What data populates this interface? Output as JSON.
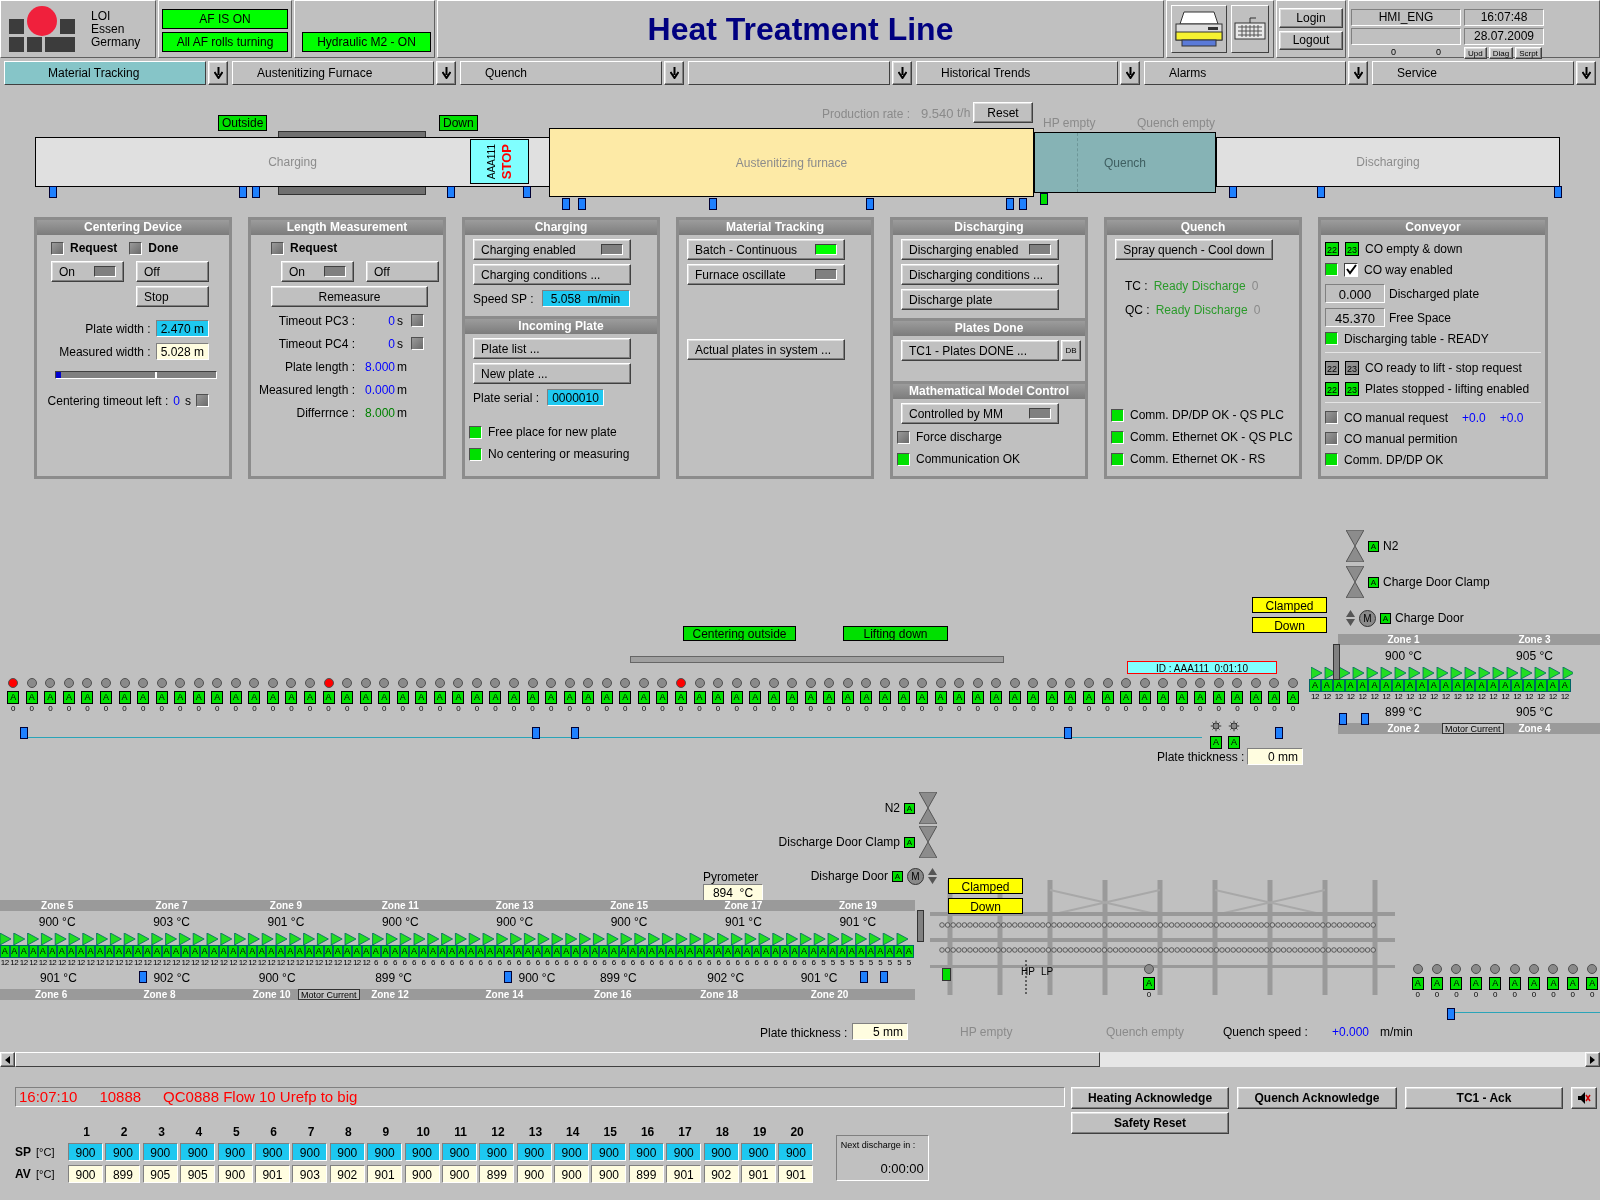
{
  "header": {
    "logo_lines": [
      "LOI",
      "Essen",
      "Germany"
    ],
    "status": [
      {
        "label": "AF IS ON",
        "on": true
      },
      {
        "label": "All AF rolls turning",
        "on": true
      },
      {
        "label": "Hydraulic M2 - ON",
        "on": true
      }
    ],
    "title": "Heat Treatment Line",
    "session_buttons": [
      "Login",
      "Logout"
    ],
    "user": "HMI_ENG",
    "time": "16:07:48",
    "date": "28.07.2009",
    "counters": [
      "0",
      "0"
    ],
    "tool_buttons": [
      "Upd",
      "Diag",
      "Scrpt"
    ]
  },
  "nav_tabs": [
    {
      "label": "Material Tracking",
      "selected": true
    },
    {
      "label": "Austenitizing Furnace",
      "selected": false
    },
    {
      "label": "Quench",
      "selected": false
    },
    {
      "selected": false
    },
    {
      "label": "Historical Trends",
      "selected": false
    },
    {
      "label": "Alarms",
      "selected": false
    },
    {
      "label": "Service",
      "selected": false
    }
  ],
  "line_overview": {
    "production_rate": {
      "label": "Production rate :",
      "value": "9.540",
      "unit": "t/h"
    },
    "reset_button": "Reset",
    "flags": [
      "Outside",
      "Down"
    ],
    "sections": [
      {
        "label": "Charging",
        "kind": "charging"
      },
      {
        "label": "Austenitizing furnace",
        "kind": "furnace"
      },
      {
        "label": "Quench",
        "kind": "quench"
      },
      {
        "label": "Discharging",
        "kind": "discharging"
      }
    ],
    "plate": {
      "id": "AAA111",
      "status": "STOP"
    },
    "notes": [
      "HP empty",
      "Quench empty"
    ]
  },
  "panels": {
    "centering": {
      "title": "Centering Device",
      "request": {
        "label": "Request",
        "on": false
      },
      "done": {
        "label": "Done",
        "on": false
      },
      "on_button": {
        "label": "On",
        "on": false
      },
      "off_button": "Off",
      "stop_button": "Stop",
      "plate_width": {
        "label": "Plate width :",
        "value": "2.470 m"
      },
      "measured_width": {
        "label": "Measured width :",
        "value": "5.028 m"
      },
      "position": {
        "level": 0.03
      },
      "timeout": {
        "label": "Centering timeout left :",
        "value": "0",
        "unit": "s",
        "on": false
      }
    },
    "length": {
      "title": "Length Measurement",
      "request": {
        "label": "Request",
        "on": false
      },
      "on_button": {
        "label": "On",
        "on": false
      },
      "off_button": "Off",
      "remeasure_button": "Remeasure",
      "rows": [
        {
          "label": "Timeout PC3 :",
          "value": "0",
          "unit": "s",
          "kind": "timer",
          "on": false
        },
        {
          "label": "Timeout PC4 :",
          "value": "0",
          "unit": "s",
          "kind": "timer",
          "on": false
        },
        {
          "label": "Plate length :",
          "value": "8.000",
          "unit": "m",
          "kind": "value"
        },
        {
          "label": "Measured length :",
          "value": "0.000",
          "unit": "m",
          "kind": "value"
        },
        {
          "label": "Differrnce :",
          "value": "8.000",
          "unit": "m",
          "kind": "difference"
        }
      ]
    },
    "charging": {
      "title": "Charging",
      "buttons": [
        {
          "label": "Charging enabled",
          "kind": "toggle",
          "on": false
        },
        {
          "label": "Charging conditions ...",
          "kind": "plain"
        }
      ],
      "speed": {
        "label": "Speed SP :",
        "value": "5.058  m/min"
      }
    },
    "incoming": {
      "title": "Incoming Plate",
      "buttons": [
        "Plate list ...",
        "New plate ..."
      ],
      "serial": {
        "label": "Plate serial :",
        "value": "0000010"
      },
      "indicators": [
        {
          "label": "Free place for new plate",
          "on": true
        },
        {
          "label": "No centering or measuring",
          "on": true
        }
      ]
    },
    "tracking": {
      "title": "Material Tracking",
      "buttons": [
        {
          "label": "Batch - Continuous",
          "kind": "toggle",
          "on": true
        },
        {
          "label": "Furnace oscillate",
          "kind": "toggle",
          "on": false
        },
        {
          "label": "Actual plates in system ...",
          "kind": "plain"
        }
      ]
    },
    "discharging": {
      "title": "Discharging",
      "buttons": [
        {
          "label": "Discharging enabled",
          "kind": "toggle",
          "on": false
        },
        {
          "label": "Discharging conditions ...",
          "kind": "plain"
        },
        {
          "label": "Discharge plate",
          "kind": "plain"
        }
      ]
    },
    "plates_done": {
      "title": "Plates Done",
      "button": "TC1 - Plates DONE ...",
      "db_button": "DB"
    },
    "mm_control": {
      "title": "Mathematical Model Control",
      "button": {
        "label": "Controlled by MM",
        "on": false
      },
      "indicators": [
        {
          "label": "Force discharge",
          "on": false
        },
        {
          "label": "Communication OK",
          "on": true
        }
      ]
    },
    "quench": {
      "title": "Quench",
      "button": "Spray quench - Cool down",
      "status": [
        {
          "label": "TC :",
          "value": "Ready Discharge",
          "count": "0"
        },
        {
          "label": "QC :",
          "value": "Ready Discharge",
          "count": "0"
        }
      ],
      "indicators": [
        {
          "label": "Comm. DP/DP OK - QS PLC",
          "on": true
        },
        {
          "label": "Comm. Ethernet OK - QS PLC",
          "on": true
        },
        {
          "label": "Comm. Ethernet OK - RS",
          "on": true
        }
      ]
    },
    "conveyor": {
      "title": "Conveyor",
      "groups": [
        [
          {
            "kind": "pair",
            "codes": [
              {
                "label": "22",
                "on": true
              },
              {
                "label": "23",
                "on": true
              }
            ],
            "label": "CO empty & down"
          },
          {
            "kind": "check",
            "on": true,
            "checked": true,
            "label": "CO way enabled"
          },
          {
            "kind": "value",
            "value": "0.000",
            "label": "Discharged plate"
          },
          {
            "kind": "value",
            "value": "45.370",
            "label": "Free Space"
          },
          {
            "kind": "lamp",
            "on": true,
            "label": "Discharging table - READY"
          }
        ],
        [
          {
            "kind": "pair",
            "codes": [
              {
                "label": "22",
                "on": false
              },
              {
                "label": "23",
                "on": false
              }
            ],
            "label": "CO ready to lift - stop request"
          },
          {
            "kind": "pair",
            "codes": [
              {
                "label": "22",
                "on": true
              },
              {
                "label": "23",
                "on": true
              }
            ],
            "label": "Plates stopped - lifting enabled"
          }
        ],
        [
          {
            "kind": "lamp",
            "on": false,
            "label": "CO manual request",
            "readings": [
              "+0.0",
              "+0.0"
            ]
          },
          {
            "kind": "lamp",
            "on": false,
            "label": "CO manual permition"
          },
          {
            "kind": "lamp",
            "on": true,
            "label": "Comm. DP/DP OK"
          }
        ]
      ]
    }
  },
  "upper_line": {
    "flags": [
      "Centering outside",
      "Lifting down"
    ],
    "plate_id": "ID : AAA111  0:01:10",
    "rollers": [
      {
        "tag": "A",
        "count": "0",
        "fault": true
      },
      {
        "tag": "A",
        "count": "0",
        "fault": false
      },
      {
        "tag": "A",
        "count": "0",
        "fault": false
      },
      {
        "tag": "A",
        "count": "0",
        "fault": false
      },
      {
        "tag": "A",
        "count": "0",
        "fault": false
      },
      {
        "tag": "A",
        "count": "0",
        "fault": false
      },
      {
        "tag": "A",
        "count": "0",
        "fault": false
      },
      {
        "tag": "A",
        "count": "0",
        "fault": false
      },
      {
        "tag": "A",
        "count": "0",
        "fault": false
      },
      {
        "tag": "A",
        "count": "0",
        "fault": false
      },
      {
        "tag": "A",
        "count": "0",
        "fault": false
      },
      {
        "tag": "A",
        "count": "0",
        "fault": false
      },
      {
        "tag": "A",
        "count": "0",
        "fault": false
      },
      {
        "tag": "A",
        "count": "0",
        "fault": false
      },
      {
        "tag": "A",
        "count": "0",
        "fault": false
      },
      {
        "tag": "A",
        "count": "0",
        "fault": false
      },
      {
        "tag": "A",
        "count": "0",
        "fault": false
      },
      {
        "tag": "A",
        "count": "0",
        "fault": true
      },
      {
        "tag": "A",
        "count": "0",
        "fault": false
      },
      {
        "tag": "A",
        "count": "0",
        "fault": false
      },
      {
        "tag": "A",
        "count": "0",
        "fault": false
      },
      {
        "tag": "A",
        "count": "0",
        "fault": false
      },
      {
        "tag": "A",
        "count": "0",
        "fault": false
      },
      {
        "tag": "A",
        "count": "0",
        "fault": false
      },
      {
        "tag": "A",
        "count": "0",
        "fault": false
      },
      {
        "tag": "A",
        "count": "0",
        "fault": false
      },
      {
        "tag": "A",
        "count": "0",
        "fault": false
      },
      {
        "tag": "A",
        "count": "0",
        "fault": false
      },
      {
        "tag": "A",
        "count": "0",
        "fault": false
      },
      {
        "tag": "A",
        "count": "0",
        "fault": false
      },
      {
        "tag": "A",
        "count": "0",
        "fault": false
      },
      {
        "tag": "A",
        "count": "0",
        "fault": false
      },
      {
        "tag": "A",
        "count": "0",
        "fault": false
      },
      {
        "tag": "A",
        "count": "0",
        "fault": false
      },
      {
        "tag": "A",
        "count": "0",
        "fault": false
      },
      {
        "tag": "A",
        "count": "0",
        "fault": false
      },
      {
        "tag": "A",
        "count": "0",
        "fault": true
      },
      {
        "tag": "A",
        "count": "0",
        "fault": false
      },
      {
        "tag": "A",
        "count": "0",
        "fault": false
      },
      {
        "tag": "A",
        "count": "0",
        "fault": false
      },
      {
        "tag": "A",
        "count": "0",
        "fault": false
      },
      {
        "tag": "A",
        "count": "0",
        "fault": false
      },
      {
        "tag": "A",
        "count": "0",
        "fault": false
      },
      {
        "tag": "A",
        "count": "0",
        "fault": false
      },
      {
        "tag": "A",
        "count": "0",
        "fault": false
      },
      {
        "tag": "A",
        "count": "0",
        "fault": false
      },
      {
        "tag": "A",
        "count": "0",
        "fault": false
      },
      {
        "tag": "A",
        "count": "0",
        "fault": false
      },
      {
        "tag": "A",
        "count": "0",
        "fault": false
      },
      {
        "tag": "A",
        "count": "0",
        "fault": false
      },
      {
        "tag": "A",
        "count": "0",
        "fault": false
      },
      {
        "tag": "A",
        "count": "0",
        "fault": false
      },
      {
        "tag": "A",
        "count": "0",
        "fault": false
      },
      {
        "tag": "A",
        "count": "0",
        "fault": false
      },
      {
        "tag": "A",
        "count": "0",
        "fault": false
      },
      {
        "tag": "A",
        "count": "0",
        "fault": false
      },
      {
        "tag": "A",
        "count": "0",
        "fault": false
      },
      {
        "tag": "A",
        "count": "0",
        "fault": false
      },
      {
        "tag": "A",
        "count": "0",
        "fault": false
      },
      {
        "tag": "A",
        "count": "0",
        "fault": false
      },
      {
        "tag": "A",
        "count": "0",
        "fault": false
      },
      {
        "tag": "A",
        "count": "0",
        "fault": false
      },
      {
        "tag": "A",
        "count": "0",
        "fault": false
      },
      {
        "tag": "A",
        "count": "0",
        "fault": false
      },
      {
        "tag": "A",
        "count": "0",
        "fault": false
      },
      {
        "tag": "A",
        "count": "0",
        "fault": false
      },
      {
        "tag": "A",
        "count": "0",
        "fault": false
      },
      {
        "tag": "A",
        "count": "0",
        "fault": false
      },
      {
        "tag": "A",
        "count": "0",
        "fault": false
      },
      {
        "tag": "A",
        "count": "0",
        "fault": false
      }
    ],
    "fans": [
      {
        "mode": "A"
      },
      {
        "mode": "A"
      }
    ],
    "plate_thickness": {
      "label": "Plate thickness :",
      "value": "0 mm"
    },
    "actuators": [
      {
        "kind": "valve",
        "mode": "A",
        "label": "N2"
      },
      {
        "kind": "valve",
        "mode": "A",
        "label": "Charge Door Clamp"
      },
      {
        "kind": "motor",
        "mode": "A",
        "motor": "M",
        "label": "Charge Door"
      }
    ],
    "door_states": [
      "Clamped",
      "Down"
    ],
    "furnace": {
      "zones_top": [
        {
          "name": "Zone 1",
          "temp": "900 °C"
        },
        {
          "name": "Zone 3",
          "temp": "905 °C"
        }
      ],
      "zones_bottom": [
        {
          "name": "Zone 2",
          "temp": "899 °C"
        },
        {
          "name": "Zone 4",
          "temp": "905 °C"
        }
      ],
      "motor_current": "Motor Current",
      "rollers": [
        {
          "tag": "A",
          "count": "12"
        },
        {
          "tag": "A",
          "count": "12"
        },
        {
          "tag": "A",
          "count": "12"
        },
        {
          "tag": "A",
          "count": "12"
        },
        {
          "tag": "A",
          "count": "12"
        },
        {
          "tag": "A",
          "count": "12"
        },
        {
          "tag": "A",
          "count": "12"
        },
        {
          "tag": "A",
          "count": "12"
        },
        {
          "tag": "A",
          "count": "12"
        },
        {
          "tag": "A",
          "count": "12"
        },
        {
          "tag": "A",
          "count": "12"
        },
        {
          "tag": "A",
          "count": "12"
        },
        {
          "tag": "A",
          "count": "12"
        },
        {
          "tag": "A",
          "count": "12"
        },
        {
          "tag": "A",
          "count": "12"
        },
        {
          "tag": "A",
          "count": "12"
        },
        {
          "tag": "A",
          "count": "12"
        },
        {
          "tag": "A",
          "count": "12"
        },
        {
          "tag": "A",
          "count": "12"
        },
        {
          "tag": "A",
          "count": "12"
        },
        {
          "tag": "A",
          "count": "12"
        },
        {
          "tag": "A",
          "count": "12"
        }
      ]
    }
  },
  "lower_line": {
    "actuators": [
      {
        "kind": "valve",
        "mode": "A",
        "label": "N2"
      },
      {
        "kind": "valve",
        "mode": "A",
        "label": "Discharge Door Clamp"
      },
      {
        "kind": "motor",
        "mode": "A",
        "motor": "M",
        "label": "Disharge Door"
      }
    ],
    "pyrometer": {
      "label": "Pyrometer",
      "value": "894  °C"
    },
    "door_states": [
      "Clamped",
      "Down"
    ],
    "furnace": {
      "zones_top": [
        {
          "name": "Zone 5",
          "temp": "900 °C"
        },
        {
          "name": "Zone 7",
          "temp": "903 °C"
        },
        {
          "name": "Zone 9",
          "temp": "901 °C"
        },
        {
          "name": "Zone 11",
          "temp": "900 °C"
        },
        {
          "name": "Zone 13",
          "temp": "900 °C"
        },
        {
          "name": "Zone 15",
          "temp": "900 °C"
        },
        {
          "name": "Zone 17",
          "temp": "901 °C"
        },
        {
          "name": "Zone 19",
          "temp": "901 °C"
        }
      ],
      "zones_bottom": [
        {
          "name": "Zone 6",
          "temp": "901 °C"
        },
        {
          "name": "Zone 8",
          "temp": "902 °C"
        },
        {
          "name": "Zone 10",
          "temp": "900 °C"
        },
        {
          "name": "Zone 12",
          "temp": "899 °C"
        },
        {
          "name": "Zone 14",
          "temp": "900 °C"
        },
        {
          "name": "Zone 16",
          "temp": "899 °C"
        },
        {
          "name": "Zone 18",
          "temp": "902 °C"
        },
        {
          "name": "Zone 20",
          "temp": "901 °C"
        }
      ],
      "motor_current": "Motor Current",
      "rollers": [
        {
          "tag": "A",
          "count": "12"
        },
        {
          "tag": "A",
          "count": "12"
        },
        {
          "tag": "A",
          "count": "12"
        },
        {
          "tag": "A",
          "count": "12"
        },
        {
          "tag": "A",
          "count": "12"
        },
        {
          "tag": "A",
          "count": "12"
        },
        {
          "tag": "A",
          "count": "12"
        },
        {
          "tag": "A",
          "count": "12"
        },
        {
          "tag": "A",
          "count": "12"
        },
        {
          "tag": "A",
          "count": "12"
        },
        {
          "tag": "A",
          "count": "12"
        },
        {
          "tag": "A",
          "count": "12"
        },
        {
          "tag": "A",
          "count": "12"
        },
        {
          "tag": "A",
          "count": "12"
        },
        {
          "tag": "A",
          "count": "12"
        },
        {
          "tag": "A",
          "count": "12"
        },
        {
          "tag": "A",
          "count": "12"
        },
        {
          "tag": "A",
          "count": "12"
        },
        {
          "tag": "A",
          "count": "12"
        },
        {
          "tag": "A",
          "count": "12"
        },
        {
          "tag": "A",
          "count": "12"
        },
        {
          "tag": "A",
          "count": "12"
        },
        {
          "tag": "A",
          "count": "12"
        },
        {
          "tag": "A",
          "count": "12"
        },
        {
          "tag": "A",
          "count": "12"
        },
        {
          "tag": "A",
          "count": "12"
        },
        {
          "tag": "A",
          "count": "12"
        },
        {
          "tag": "A",
          "count": "12"
        },
        {
          "tag": "A",
          "count": "12"
        },
        {
          "tag": "A",
          "count": "12"
        },
        {
          "tag": "A",
          "count": "12"
        },
        {
          "tag": "A",
          "count": "12"
        },
        {
          "tag": "A",
          "count": "12"
        },
        {
          "tag": "A",
          "count": "12"
        },
        {
          "tag": "A",
          "count": "12"
        },
        {
          "tag": "A",
          "count": "12"
        },
        {
          "tag": "A",
          "count": "12"
        },
        {
          "tag": "A",
          "count": "12"
        },
        {
          "tag": "A",
          "count": "12"
        },
        {
          "tag": "A",
          "count": "6"
        },
        {
          "tag": "A",
          "count": "6"
        },
        {
          "tag": "A",
          "count": "6"
        },
        {
          "tag": "A",
          "count": "6"
        },
        {
          "tag": "A",
          "count": "6"
        },
        {
          "tag": "A",
          "count": "6"
        },
        {
          "tag": "A",
          "count": "6"
        },
        {
          "tag": "A",
          "count": "6"
        },
        {
          "tag": "A",
          "count": "6"
        },
        {
          "tag": "A",
          "count": "6"
        },
        {
          "tag": "A",
          "count": "6"
        },
        {
          "tag": "A",
          "count": "6"
        },
        {
          "tag": "A",
          "count": "6"
        },
        {
          "tag": "A",
          "count": "6"
        },
        {
          "tag": "A",
          "count": "6"
        },
        {
          "tag": "A",
          "count": "6"
        },
        {
          "tag": "A",
          "count": "6"
        },
        {
          "tag": "A",
          "count": "6"
        },
        {
          "tag": "A",
          "count": "6"
        },
        {
          "tag": "A",
          "count": "6"
        },
        {
          "tag": "A",
          "count": "6"
        },
        {
          "tag": "A",
          "count": "6"
        },
        {
          "tag": "A",
          "count": "6"
        },
        {
          "tag": "A",
          "count": "6"
        },
        {
          "tag": "A",
          "count": "6"
        },
        {
          "tag": "A",
          "count": "6"
        },
        {
          "tag": "A",
          "count": "6"
        },
        {
          "tag": "A",
          "count": "6"
        },
        {
          "tag": "A",
          "count": "6"
        },
        {
          "tag": "A",
          "count": "6"
        },
        {
          "tag": "A",
          "count": "6"
        },
        {
          "tag": "A",
          "count": "6"
        },
        {
          "tag": "A",
          "count": "6"
        },
        {
          "tag": "A",
          "count": "6"
        },
        {
          "tag": "A",
          "count": "6"
        },
        {
          "tag": "A",
          "count": "6"
        },
        {
          "tag": "A",
          "count": "6"
        },
        {
          "tag": "A",
          "count": "6"
        },
        {
          "tag": "A",
          "count": "6"
        },
        {
          "tag": "A",
          "count": "6"
        },
        {
          "tag": "A",
          "count": "6"
        },
        {
          "tag": "A",
          "count": "6"
        },
        {
          "tag": "A",
          "count": "6"
        },
        {
          "tag": "A",
          "count": "6"
        },
        {
          "tag": "A",
          "count": "6"
        },
        {
          "tag": "A",
          "count": "6"
        },
        {
          "tag": "A",
          "count": "6"
        },
        {
          "tag": "A",
          "count": "5"
        },
        {
          "tag": "A",
          "count": "5"
        },
        {
          "tag": "A",
          "count": "5"
        },
        {
          "tag": "A",
          "count": "5"
        },
        {
          "tag": "A",
          "count": "5"
        },
        {
          "tag": "A",
          "count": "5"
        },
        {
          "tag": "A",
          "count": "5"
        },
        {
          "tag": "A",
          "count": "5"
        },
        {
          "tag": "A",
          "count": "5"
        },
        {
          "tag": "A",
          "count": "5"
        }
      ]
    },
    "plate_thickness": {
      "label": "Plate thickness :",
      "value": "5 mm"
    },
    "quench": {
      "hp_lp": [
        "HP",
        "LP"
      ],
      "roller": {
        "tag": "A",
        "count": "0"
      },
      "notes": [
        "HP empty",
        "Quench empty"
      ],
      "speed": {
        "label": "Quench speed :",
        "value": "+0.000",
        "unit": "m/min"
      }
    },
    "exit_rollers": [
      {
        "tag": "A",
        "count": "0"
      },
      {
        "tag": "A",
        "count": "0"
      },
      {
        "tag": "A",
        "count": "0"
      },
      {
        "tag": "A",
        "count": "0"
      },
      {
        "tag": "A",
        "count": "0"
      },
      {
        "tag": "A",
        "count": "0"
      },
      {
        "tag": "A",
        "count": "0"
      },
      {
        "tag": "A",
        "count": "0"
      },
      {
        "tag": "A",
        "count": "0"
      },
      {
        "tag": "A",
        "count": "0"
      }
    ]
  },
  "footer": {
    "alarm": {
      "time": "16:07:10",
      "code": "10888",
      "message": "QC0888 Flow 10 Urefp to big"
    },
    "ack_buttons": [
      "Heating Acknowledge",
      "Quench Acknowledge",
      "TC1 - Ack"
    ],
    "safety_reset": "Safety Reset",
    "temperature_table": {
      "columns": [
        "1",
        "2",
        "3",
        "4",
        "5",
        "6",
        "7",
        "8",
        "9",
        "10",
        "11",
        "12",
        "13",
        "14",
        "15",
        "16",
        "17",
        "18",
        "19",
        "20"
      ],
      "rows": [
        {
          "label": "SP",
          "unit": "[°C]",
          "kind": "setpoint",
          "values": [
            "900",
            "900",
            "900",
            "900",
            "900",
            "900",
            "900",
            "900",
            "900",
            "900",
            "900",
            "900",
            "900",
            "900",
            "900",
            "900",
            "900",
            "900",
            "900",
            "900"
          ]
        },
        {
          "label": "AV",
          "unit": "[°C]",
          "kind": "actual",
          "values": [
            "900",
            "899",
            "905",
            "905",
            "900",
            "901",
            "903",
            "902",
            "901",
            "900",
            "900",
            "899",
            "900",
            "900",
            "900",
            "899",
            "901",
            "902",
            "901",
            "901"
          ]
        }
      ]
    },
    "next_discharge": {
      "label": "Next discharge in :",
      "value": "0:00:00"
    }
  }
}
